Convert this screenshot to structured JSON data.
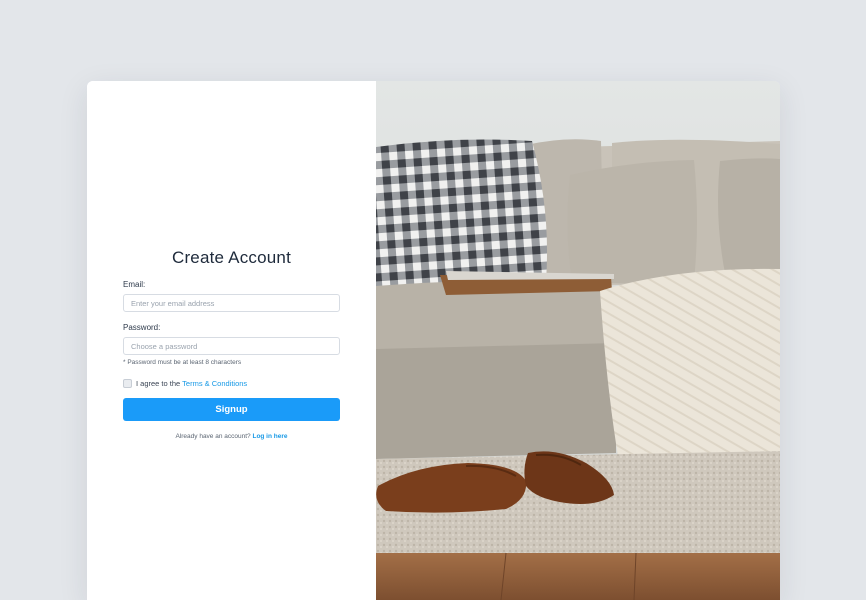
{
  "form": {
    "title": "Create Account",
    "email_label": "Email:",
    "email_placeholder": "Enter your email address",
    "email_value": "",
    "password_label": "Password:",
    "password_placeholder": "Choose a password",
    "password_value": "",
    "password_hint": "* Password must be at least 8 characters",
    "agree_prefix": "I agree to the",
    "terms_link": "Terms & Conditions",
    "agree_checked": false,
    "submit_label": "Signup",
    "login_prompt": "Already have an account?",
    "login_link": "Log in here"
  },
  "colors": {
    "page_background": "#e3e6ea",
    "accent": "#1a9bf9",
    "link": "#1799e6",
    "heading": "#1e2a3b"
  },
  "image": {
    "description_icon": "living-room-photo"
  }
}
